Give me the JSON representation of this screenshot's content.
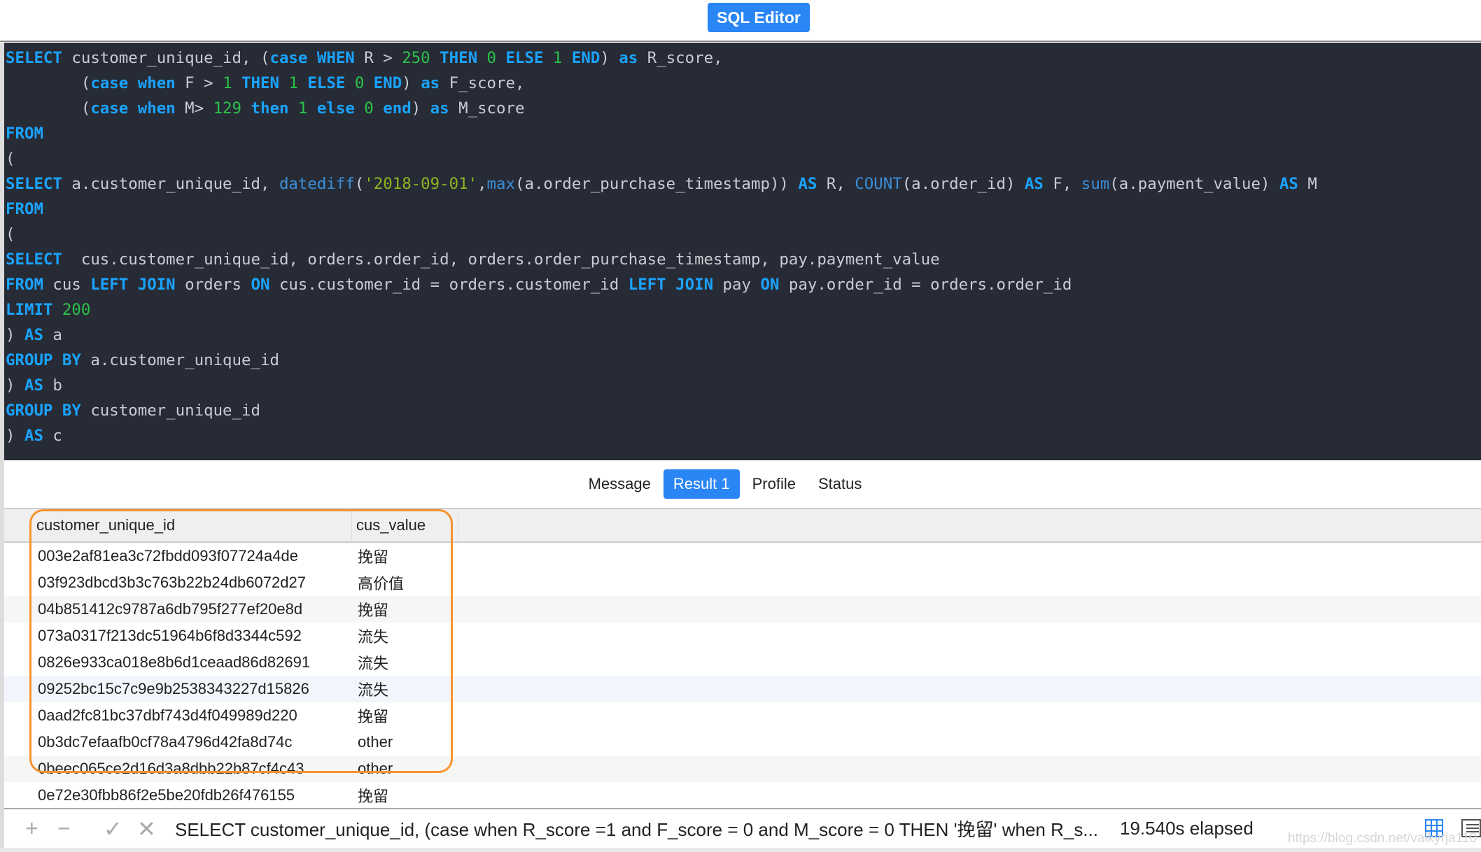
{
  "header": {
    "title": "SQL Editor"
  },
  "colors": {
    "accent": "#2a86f5",
    "highlight_box": "#f7922d",
    "editor_bg": "#272b35",
    "keyword": "#1aa3ff",
    "number": "#2bc24a",
    "string": "#8fb521"
  },
  "editor": {
    "lines": [
      [
        [
          "kw",
          "SELECT"
        ],
        [
          "pl",
          " customer_unique_id, ("
        ],
        [
          "kw",
          "case WHEN"
        ],
        [
          "pl",
          " R > "
        ],
        [
          "num",
          "250"
        ],
        [
          "kw",
          " THEN "
        ],
        [
          "num",
          "0"
        ],
        [
          "kw",
          " ELSE "
        ],
        [
          "num",
          "1"
        ],
        [
          "kw",
          " END"
        ],
        [
          "pl",
          ") "
        ],
        [
          "kw",
          "as"
        ],
        [
          "pl",
          " R_score,"
        ]
      ],
      [
        [
          "pl",
          "        ("
        ],
        [
          "kw",
          "case when"
        ],
        [
          "pl",
          " F > "
        ],
        [
          "num",
          "1"
        ],
        [
          "kw",
          " THEN "
        ],
        [
          "num",
          "1"
        ],
        [
          "kw",
          " ELSE "
        ],
        [
          "num",
          "0"
        ],
        [
          "kw",
          " END"
        ],
        [
          "pl",
          ") "
        ],
        [
          "kw",
          "as"
        ],
        [
          "pl",
          " F_score,"
        ]
      ],
      [
        [
          "pl",
          "        ("
        ],
        [
          "kw",
          "case when"
        ],
        [
          "pl",
          " M> "
        ],
        [
          "num",
          "129"
        ],
        [
          "kw",
          " then "
        ],
        [
          "num",
          "1"
        ],
        [
          "kw",
          " else "
        ],
        [
          "num",
          "0"
        ],
        [
          "kw",
          " end"
        ],
        [
          "pl",
          ") "
        ],
        [
          "kw",
          "as"
        ],
        [
          "pl",
          " M_score"
        ]
      ],
      [
        [
          "kw",
          "FROM"
        ]
      ],
      [
        [
          "pl",
          "("
        ]
      ],
      [
        [
          "kw",
          "SELECT"
        ],
        [
          "pl",
          " a.customer_unique_id, "
        ],
        [
          "fn",
          "datediff"
        ],
        [
          "pl",
          "("
        ],
        [
          "str",
          "'2018-09-01'"
        ],
        [
          "pl",
          ","
        ],
        [
          "fn",
          "max"
        ],
        [
          "pl",
          "(a.order_purchase_timestamp)) "
        ],
        [
          "kw",
          "AS"
        ],
        [
          "pl",
          " R, "
        ],
        [
          "fn",
          "COUNT"
        ],
        [
          "pl",
          "(a.order_id) "
        ],
        [
          "kw",
          "AS"
        ],
        [
          "pl",
          " F, "
        ],
        [
          "fn",
          "sum"
        ],
        [
          "pl",
          "(a.payment_value) "
        ],
        [
          "kw",
          "AS"
        ],
        [
          "pl",
          " M"
        ]
      ],
      [
        [
          "kw",
          "FROM"
        ]
      ],
      [
        [
          "pl",
          "("
        ]
      ],
      [
        [
          "kw",
          "SELECT"
        ],
        [
          "pl",
          "  cus.customer_unique_id, orders.order_id, orders.order_purchase_timestamp, pay.payment_value"
        ]
      ],
      [
        [
          "kw",
          "FROM"
        ],
        [
          "pl",
          " cus "
        ],
        [
          "kw",
          "LEFT JOIN"
        ],
        [
          "pl",
          " orders "
        ],
        [
          "kw",
          "ON"
        ],
        [
          "pl",
          " cus.customer_id = orders.customer_id "
        ],
        [
          "kw",
          "LEFT JOIN"
        ],
        [
          "pl",
          " pay "
        ],
        [
          "kw",
          "ON"
        ],
        [
          "pl",
          " pay.order_id = orders.order_id"
        ]
      ],
      [
        [
          "kw",
          "LIMIT"
        ],
        [
          "num",
          " 200"
        ]
      ],
      [
        [
          "pl",
          ") "
        ],
        [
          "kw",
          "AS"
        ],
        [
          "pl",
          " a"
        ]
      ],
      [
        [
          "kw",
          "GROUP BY"
        ],
        [
          "pl",
          " a.customer_unique_id"
        ]
      ],
      [
        [
          "pl",
          ") "
        ],
        [
          "kw",
          "AS"
        ],
        [
          "pl",
          " b"
        ]
      ],
      [
        [
          "kw",
          "GROUP BY"
        ],
        [
          "pl",
          " customer_unique_id"
        ]
      ],
      [
        [
          "pl",
          ") "
        ],
        [
          "kw",
          "AS"
        ],
        [
          "pl",
          " c"
        ]
      ]
    ]
  },
  "tabs": [
    {
      "label": "Message"
    },
    {
      "label": "Result 1",
      "active": true
    },
    {
      "label": "Profile"
    },
    {
      "label": "Status"
    }
  ],
  "table": {
    "columns": [
      "customer_unique_id",
      "cus_value"
    ],
    "rows": [
      [
        "003e2af81ea3c72fbdd093f07724a4de",
        "挽留"
      ],
      [
        "03f923dbcd3b3c763b22b24db6072d27",
        "高价值"
      ],
      [
        "04b851412c9787a6db795f277ef20e8d",
        "挽留"
      ],
      [
        "073a0317f213dc51964b6f8d3344c592",
        "流失"
      ],
      [
        "0826e933ca018e8b6d1ceaad86d82691",
        "流失"
      ],
      [
        "09252bc15c7c9e9b2538343227d15826",
        "流失"
      ],
      [
        "0aad2fc81bc37dbf743d4f049989d220",
        "挽留"
      ],
      [
        "0b3dc7efaafb0cf78a4796d42fa8d74c",
        "other"
      ],
      [
        "0beec065ce2d16d3a8dbb22b87cf4c43",
        "other"
      ],
      [
        "0e72e30fbb86f2e5be20fdb26f476155",
        "挽留"
      ]
    ]
  },
  "footer": {
    "add_icon": "plus",
    "remove_icon": "minus",
    "apply_icon": "check",
    "discard_icon": "x",
    "query": "SELECT customer_unique_id, (case when R_score =1 and F_score = 0 and M_score = 0 THEN '挽留' when R_s...",
    "elapsed": "19.540s elapsed",
    "grid_view_icon": "grid",
    "form_view_icon": "list"
  },
  "watermark": "https://blog.csdn.net/valkyrja110"
}
